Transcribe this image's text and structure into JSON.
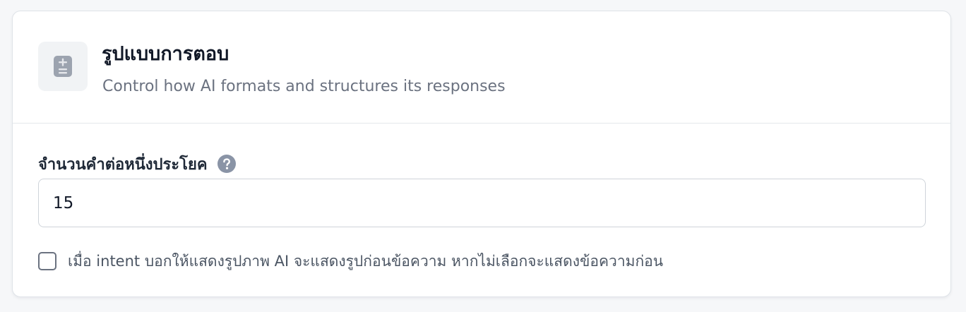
{
  "card": {
    "icon": "calculator-icon",
    "title": "รูปแบบการตอบ",
    "subtitle": "Control how AI formats and structures its responses"
  },
  "field": {
    "label": "จำนวนคำต่อหนึ่งประโยค",
    "help_icon": "help-circle-icon",
    "value": "15"
  },
  "option": {
    "checked": false,
    "label": "เมื่อ intent บอกให้แสดงรูปภาพ AI จะแสดงรูปก่อนข้อความ หากไม่เลือกจะแสดงข้อความก่อน"
  },
  "colors": {
    "page_background": "#f6f7f9",
    "card_background": "#ffffff",
    "icon_gray": "#9ca3af",
    "help_icon_gray": "#8a94a6",
    "title_text": "#111827",
    "muted_text": "#6b7280"
  }
}
